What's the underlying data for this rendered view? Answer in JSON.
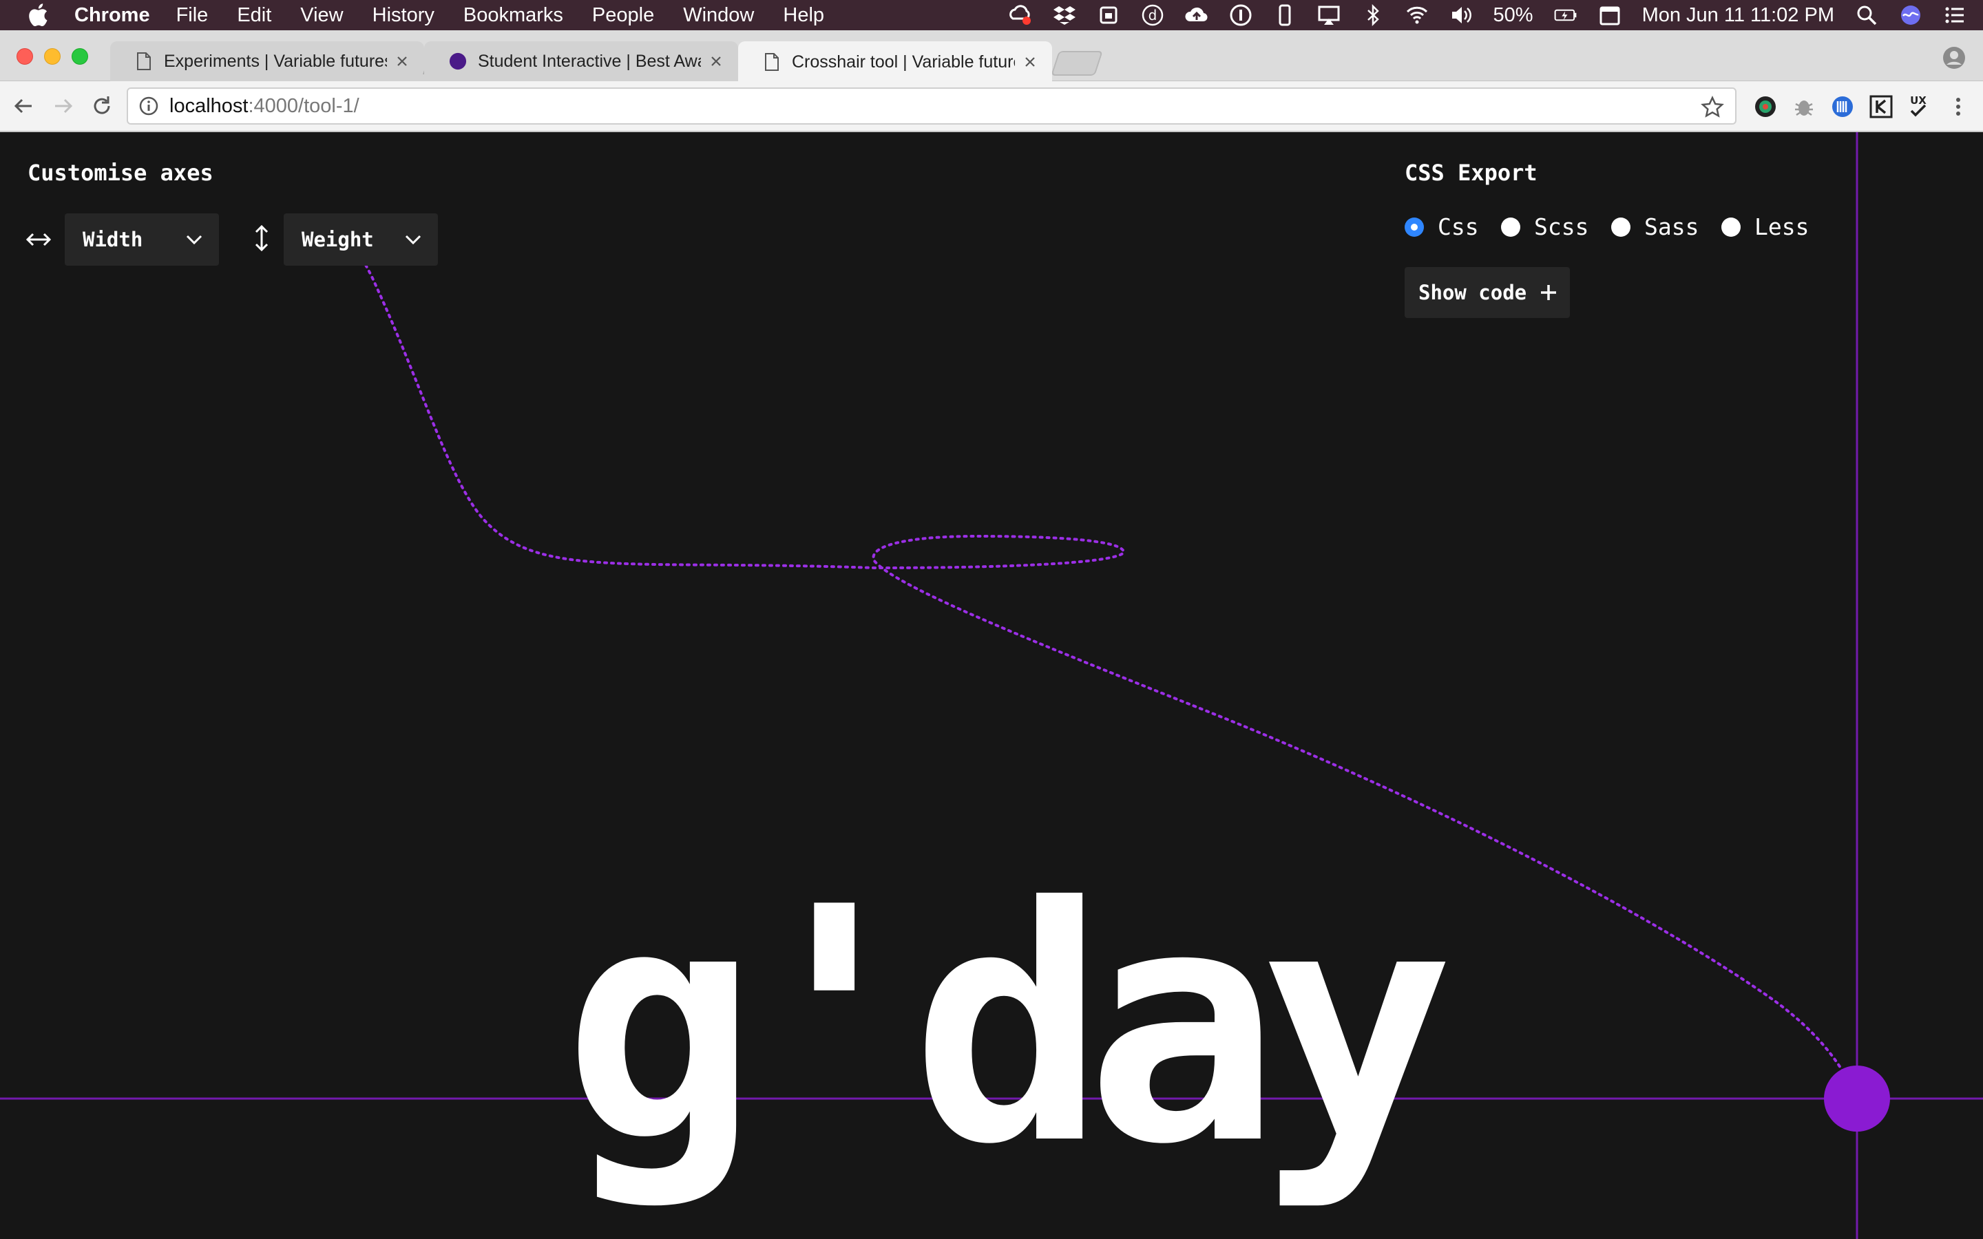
{
  "menubar": {
    "items": [
      "Chrome",
      "File",
      "Edit",
      "View",
      "History",
      "Bookmarks",
      "People",
      "Window",
      "Help"
    ],
    "battery": "50%",
    "datetime": "Mon Jun 11  11:02 PM"
  },
  "tabs": [
    {
      "title": "Experiments | Variable futures",
      "active": false,
      "favicon": "page-icon"
    },
    {
      "title": "Student Interactive | Best Awa",
      "active": false,
      "favicon": "purple-circle-icon"
    },
    {
      "title": "Crosshair tool | Variable future",
      "active": true,
      "favicon": "page-icon"
    }
  ],
  "address": {
    "host": "localhost",
    "path": ":4000/tool-1/"
  },
  "page": {
    "axes_title": "Customise axes",
    "x_axis_select": "Width",
    "y_axis_select": "Weight",
    "css_title": "CSS Export",
    "formats": [
      {
        "label": "Css",
        "selected": true
      },
      {
        "label": "Scss",
        "selected": false
      },
      {
        "label": "Sass",
        "selected": false
      },
      {
        "label": "Less",
        "selected": false
      }
    ],
    "show_code": "Show code",
    "specimen": "g'day"
  },
  "colors": {
    "background": "#161616",
    "accent_purple": "#8a1bd2",
    "radio_selected": "#2f86ff"
  }
}
